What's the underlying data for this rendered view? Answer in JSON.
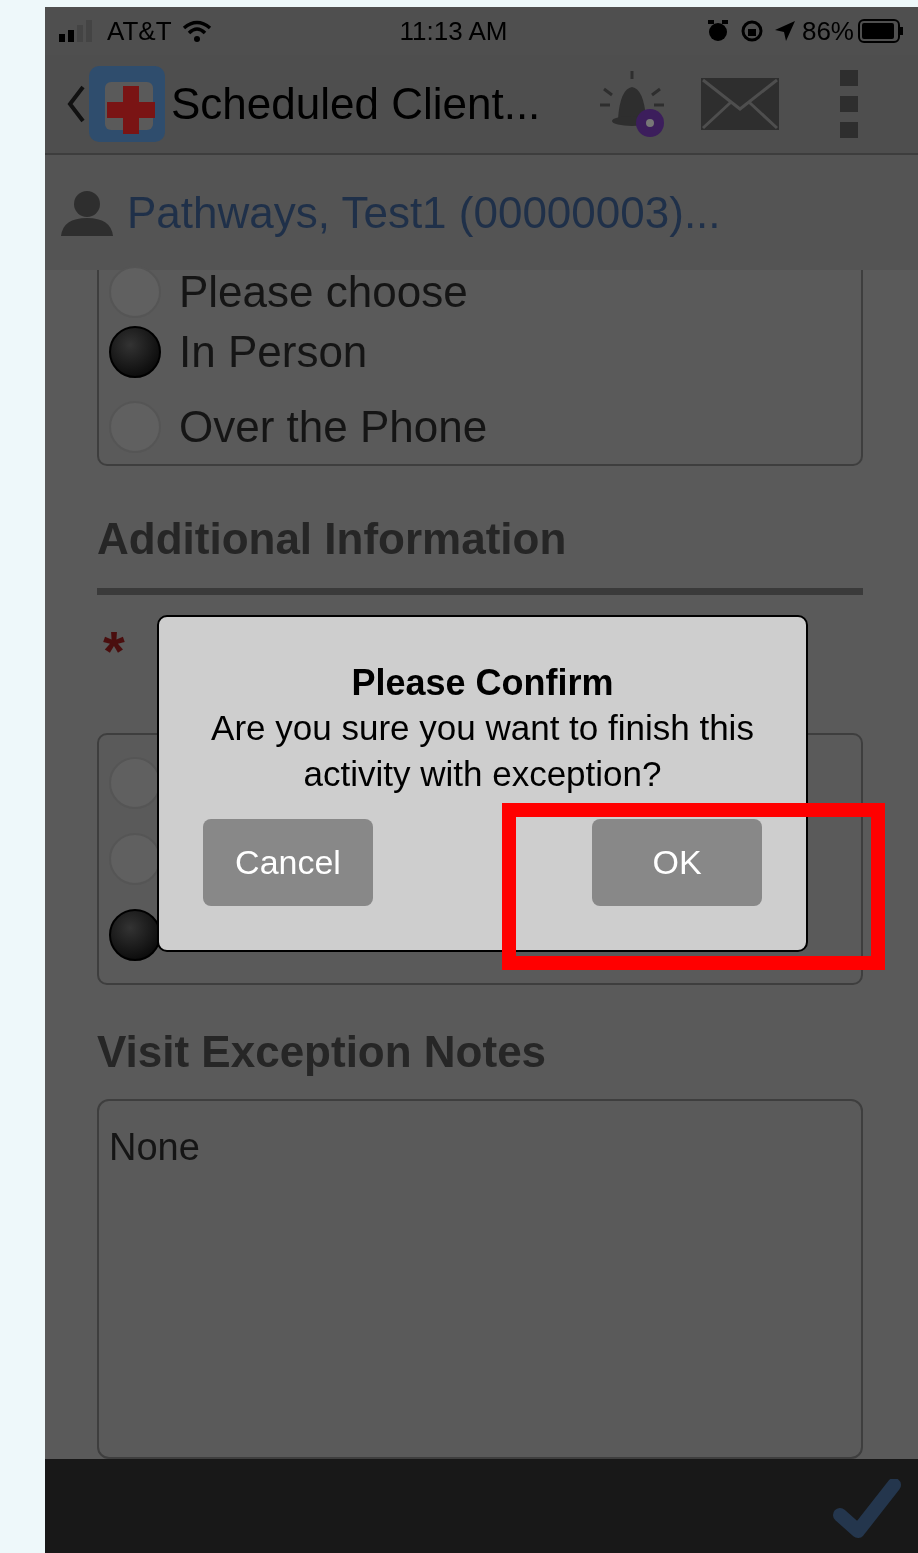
{
  "status_bar": {
    "carrier": "AT&T",
    "time": "11:13 AM",
    "battery": "86%"
  },
  "header": {
    "title": "Scheduled Client..."
  },
  "patient": {
    "name": "Pathways, Test1 (00000003)..."
  },
  "visit_type": {
    "options": [
      {
        "label": "Please choose",
        "selected": false
      },
      {
        "label": "In Person",
        "selected": true
      },
      {
        "label": "Over the Phone",
        "selected": false
      }
    ]
  },
  "section_title": "Additional Information",
  "question": {
    "required_mark": "*",
    "options": [
      {
        "selected": false
      },
      {
        "selected": false
      },
      {
        "selected": true
      }
    ]
  },
  "notes": {
    "label": "Visit Exception Notes",
    "value": "None"
  },
  "dialog": {
    "title": "Please Confirm",
    "message": "Are you sure you want to finish this activity with exception?",
    "buttons": [
      "Cancel",
      "OK"
    ]
  }
}
